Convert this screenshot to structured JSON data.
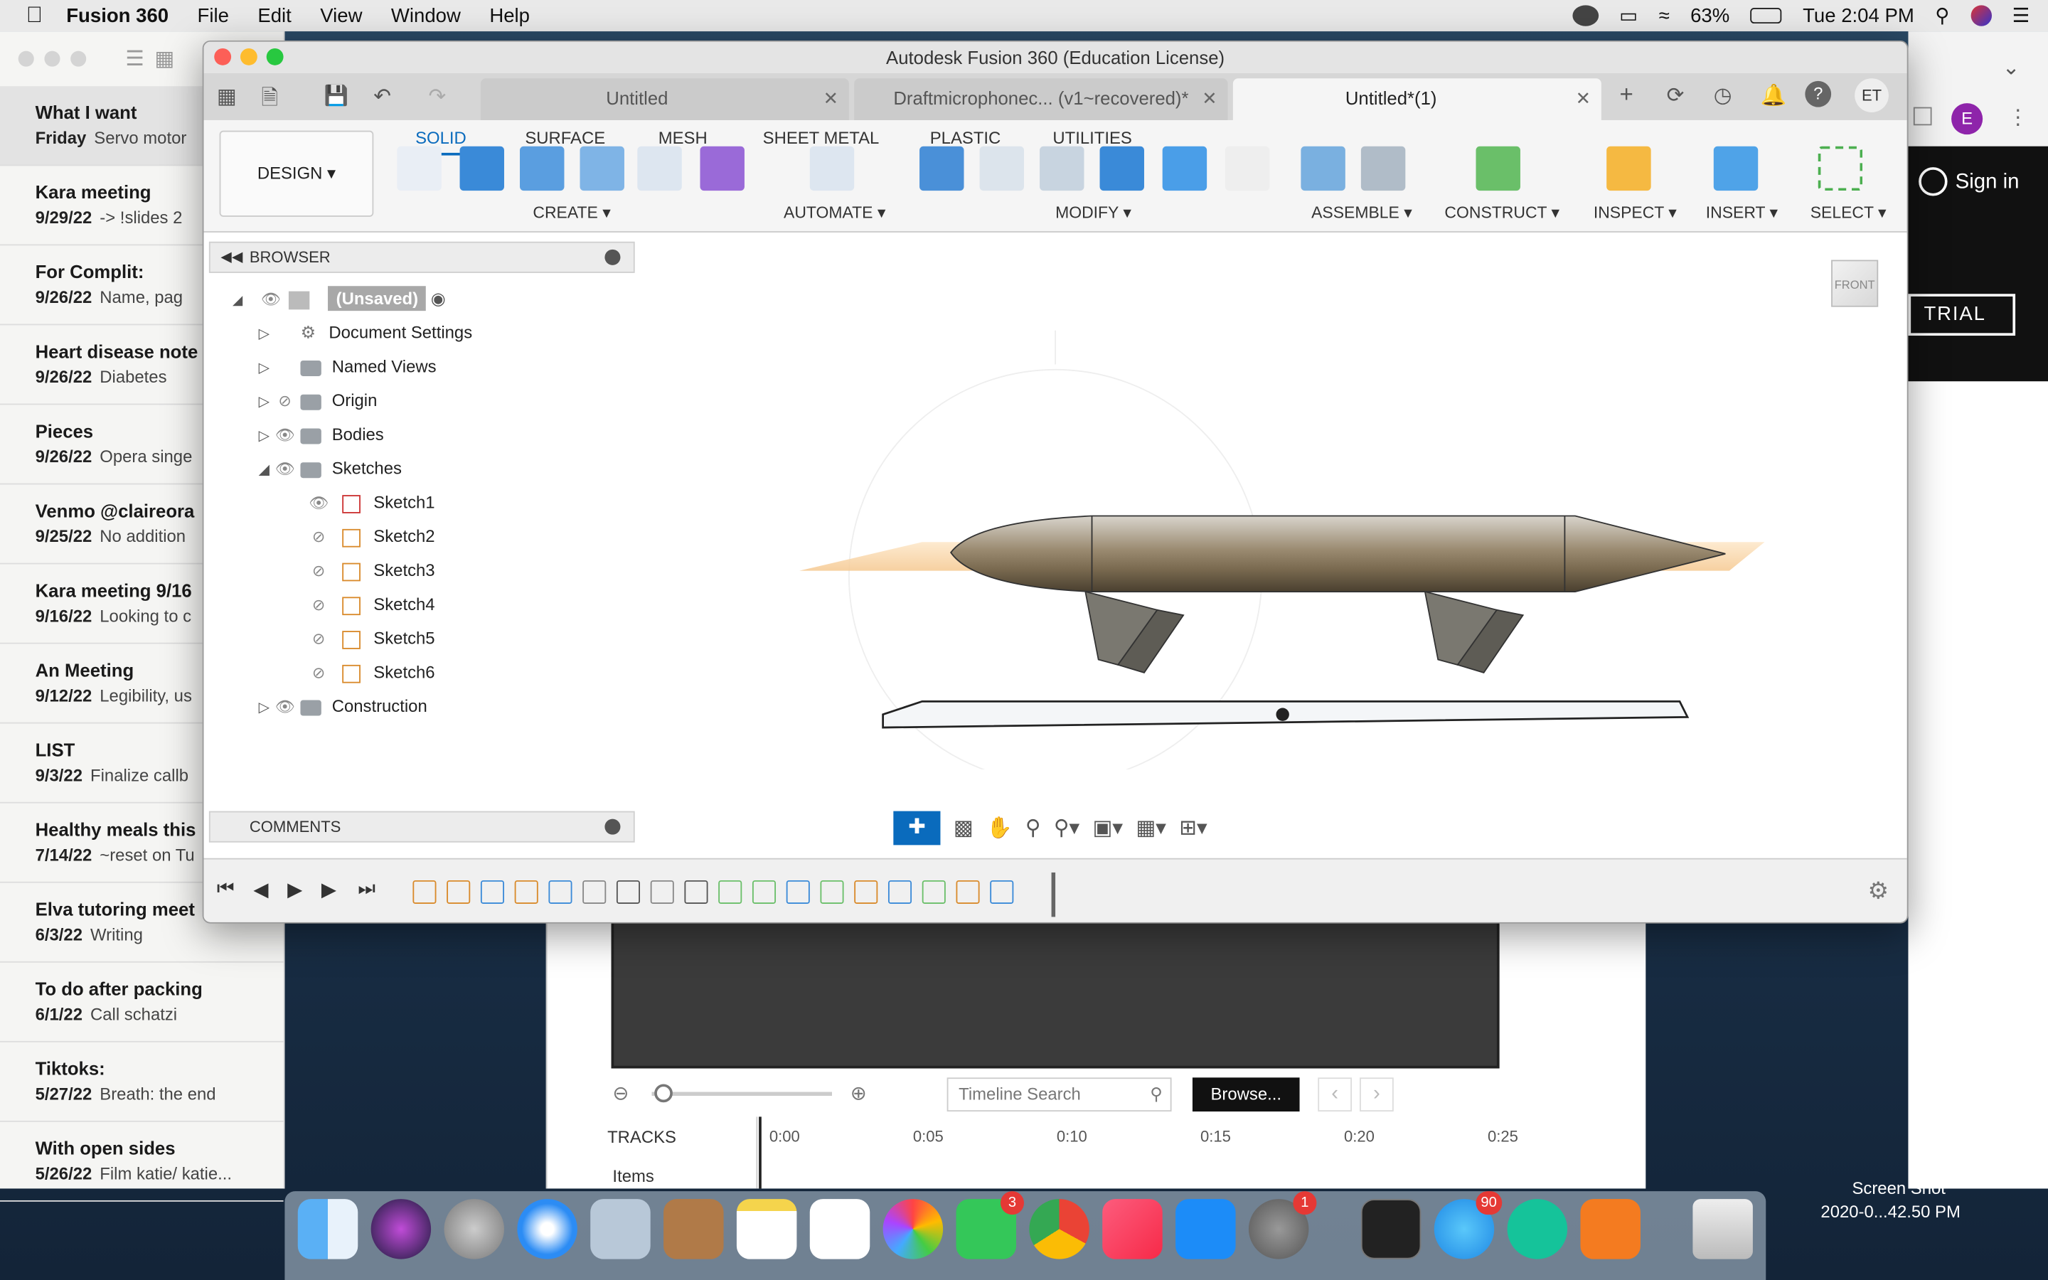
{
  "menubar": {
    "app": "Fusion 360",
    "items": [
      "File",
      "Edit",
      "View",
      "Window",
      "Help"
    ],
    "battery": "63%",
    "clock": "Tue 2:04 PM"
  },
  "notes": [
    {
      "title": "What I want",
      "date": "Friday",
      "snippet": "Servo motor"
    },
    {
      "title": "Kara meeting",
      "date": "9/29/22",
      "snippet": "-> !slides 2"
    },
    {
      "title": "For Complit:",
      "date": "9/26/22",
      "snippet": "Name, pag"
    },
    {
      "title": "Heart disease note",
      "date": "9/26/22",
      "snippet": "Diabetes"
    },
    {
      "title": "Pieces",
      "date": "9/26/22",
      "snippet": "Opera singe"
    },
    {
      "title": "Venmo @claireora",
      "date": "9/25/22",
      "snippet": "No addition"
    },
    {
      "title": "Kara meeting 9/16",
      "date": "9/16/22",
      "snippet": "Looking to c"
    },
    {
      "title": "An Meeting",
      "date": "9/12/22",
      "snippet": "Legibility, us"
    },
    {
      "title": "LIST",
      "date": "9/3/22",
      "snippet": "Finalize callb"
    },
    {
      "title": "Healthy meals this",
      "date": "7/14/22",
      "snippet": "~reset on Tu"
    },
    {
      "title": "Elva tutoring meet",
      "date": "6/3/22",
      "snippet": "Writing"
    },
    {
      "title": "To do after packing",
      "date": "6/1/22",
      "snippet": "Call schatzi"
    },
    {
      "title": "Tiktoks:",
      "date": "5/27/22",
      "snippet": "Breath: the end"
    },
    {
      "title": "With open sides",
      "date": "5/26/22",
      "snippet": "Film katie/ katie..."
    }
  ],
  "fusion": {
    "window_title": "Autodesk Fusion 360 (Education License)",
    "doc_tabs": [
      "Untitled",
      "Draftmicrophonec... (v1~recovered)*",
      "Untitled*(1)"
    ],
    "user_initials": "ET",
    "workspace": "DESIGN",
    "ribbon_tabs": [
      "SOLID",
      "SURFACE",
      "MESH",
      "SHEET METAL",
      "PLASTIC",
      "UTILITIES"
    ],
    "groups": [
      "CREATE",
      "AUTOMATE",
      "MODIFY",
      "ASSEMBLE",
      "CONSTRUCT",
      "INSPECT",
      "INSERT",
      "SELECT"
    ],
    "browser": {
      "title": "BROWSER",
      "root": "(Unsaved)",
      "items": [
        "Document Settings",
        "Named Views",
        "Origin",
        "Bodies",
        "Sketches"
      ],
      "sketches": [
        "Sketch1",
        "Sketch2",
        "Sketch3",
        "Sketch4",
        "Sketch5",
        "Sketch6"
      ],
      "construction": "Construction"
    },
    "comments": "COMMENTS",
    "viewcube": "FRONT"
  },
  "right_browser": {
    "sign_in": "Sign in",
    "trial": "TRIAL",
    "user": "E"
  },
  "editor": {
    "search_placeholder": "Timeline Search",
    "browse": "Browse...",
    "tracks": "TRACKS",
    "items": "Items",
    "ticks": [
      "0:00",
      "0:05",
      "0:10",
      "0:15",
      "0:20",
      "0:25"
    ]
  },
  "desktop": {
    "screenshot_label1": "Screen Shot",
    "screenshot_label2": "2020-0...42.50 PM"
  },
  "dock_badges": {
    "facetime": "3",
    "settings": "1",
    "messages": "90"
  }
}
